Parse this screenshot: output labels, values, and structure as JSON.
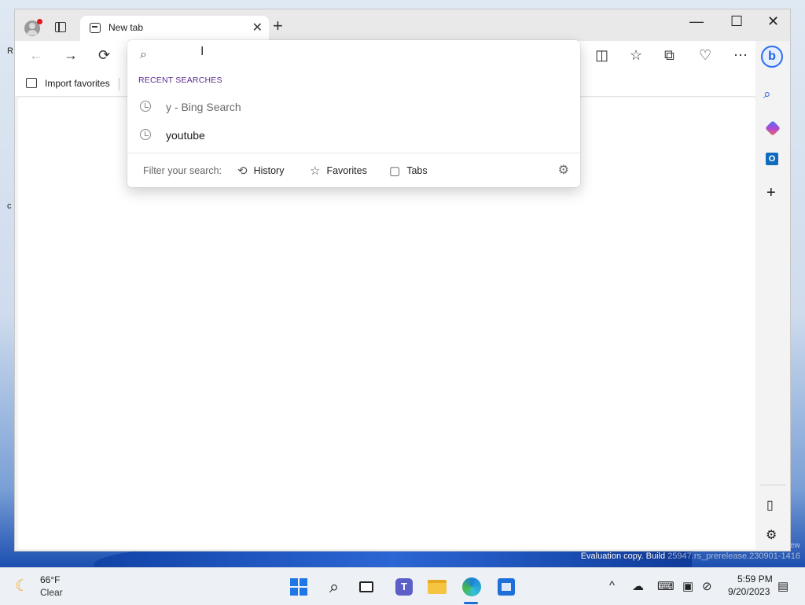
{
  "desktop": {
    "fragments": [
      "R",
      "c"
    ],
    "watermark_left": "Evaluation copy. Build ",
    "watermark_right": "25947.rs_prerelease.230901-1416",
    "watermark_corner": "ew"
  },
  "browser": {
    "tab": {
      "title": "New tab",
      "close": "✕"
    },
    "new_tab": "+",
    "window_controls": {
      "minimize": "—",
      "maximize": "☐",
      "close": "✕"
    },
    "nav": {
      "back": "←",
      "forward": "→",
      "refresh": "⟳"
    },
    "toolbar_icons": {
      "split": "◫",
      "favorites": "☆",
      "collections": "⧉",
      "health": "♡",
      "more": "⋯"
    },
    "favorites_bar": {
      "import_label": "Import favorites"
    },
    "sidebar": {
      "bing": "b",
      "outlook": "O",
      "add": "+",
      "panel": "▯",
      "settings": "⚙"
    }
  },
  "dropdown": {
    "search_placeholder": "",
    "search_value": "",
    "heading": "RECENT SEARCHES",
    "items": [
      {
        "text": "y - Bing Search",
        "icon": "history-icon"
      },
      {
        "text": "youtube",
        "icon": "history-icon"
      }
    ],
    "filter_label": "Filter your search:",
    "filters": [
      {
        "label": "History",
        "icon": "history-icon"
      },
      {
        "label": "Favorites",
        "icon": "star-icon"
      },
      {
        "label": "Tabs",
        "icon": "tabs-icon"
      }
    ]
  },
  "taskbar": {
    "weather": {
      "temp": "66°F",
      "desc": "Clear"
    },
    "clock": {
      "time": "5:59 PM",
      "date": "9/20/2023"
    },
    "tray": {
      "chevron": "^",
      "keyboard": "⌨",
      "notifications": "▤"
    }
  }
}
